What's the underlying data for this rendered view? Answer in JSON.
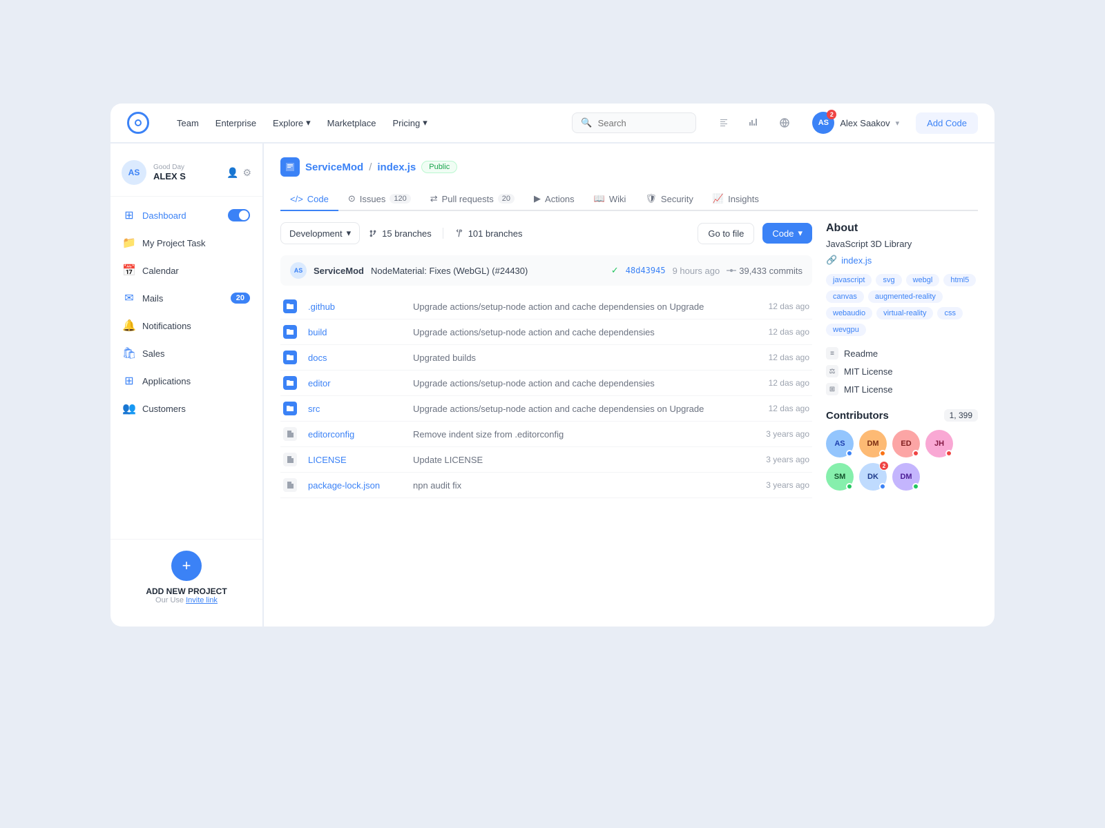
{
  "topNav": {
    "links": [
      {
        "label": "Team",
        "hasDropdown": false
      },
      {
        "label": "Enterprise",
        "hasDropdown": false
      },
      {
        "label": "Explore",
        "hasDropdown": true
      },
      {
        "label": "Marketplace",
        "hasDropdown": false
      },
      {
        "label": "Pricing",
        "hasDropdown": true
      }
    ],
    "search": {
      "placeholder": "Search"
    },
    "user": {
      "initials": "AS",
      "name": "Alex Saakov",
      "badgeCount": "2"
    },
    "addCodeLabel": "Add Code"
  },
  "sidebar": {
    "user": {
      "greeting": "Good Day",
      "name": "ALEX S",
      "initials": "AS"
    },
    "items": [
      {
        "label": "Dashboard",
        "icon": "grid",
        "active": true,
        "hasToggle": true
      },
      {
        "label": "My Project Task",
        "icon": "folder",
        "active": false
      },
      {
        "label": "Calendar",
        "icon": "calendar",
        "active": false
      },
      {
        "label": "Mails",
        "icon": "mail",
        "active": false,
        "badge": "20"
      },
      {
        "label": "Notifications",
        "icon": "bell",
        "active": false
      },
      {
        "label": "Sales",
        "icon": "bag",
        "active": false
      },
      {
        "label": "Applications",
        "icon": "apps",
        "active": false
      },
      {
        "label": "Customers",
        "icon": "people",
        "active": false
      }
    ],
    "addProject": {
      "title": "ADD NEW PROJECT",
      "subtitle": "Our Use",
      "inviteLabel": "Invite link"
    }
  },
  "repo": {
    "icon": "📄",
    "name": "ServiceMod",
    "file": "index.js",
    "visibility": "Public",
    "tabs": [
      {
        "label": "Code",
        "icon": "code",
        "count": null
      },
      {
        "label": "Issues",
        "icon": "circle",
        "count": "120"
      },
      {
        "label": "Pull requests",
        "icon": "git",
        "count": "20"
      },
      {
        "label": "Actions",
        "icon": "play",
        "count": null
      },
      {
        "label": "Wiki",
        "icon": "book",
        "count": null
      },
      {
        "label": "Security",
        "icon": "shield",
        "count": null
      },
      {
        "label": "Insights",
        "icon": "chart",
        "count": null
      }
    ],
    "branch": {
      "current": "Development",
      "branchCount15": "15 branches",
      "branchCount101": "101 branches",
      "gotoFile": "Go to file",
      "codeLabel": "Code"
    },
    "latestCommit": {
      "initials": "AS",
      "user": "ServiceMod",
      "message": "NodeMaterial: Fixes (WebGL) (#24430)",
      "hash": "48d43945",
      "time": "9 hours ago",
      "commits": "39,433 commits"
    },
    "files": [
      {
        "type": "folder",
        "name": ".github",
        "message": "Upgrade actions/setup-node action and cache dependensies on Upgrade",
        "time": "12 das ago"
      },
      {
        "type": "folder",
        "name": "build",
        "message": "Upgrade actions/setup-node action and cache dependensies",
        "time": "12 das ago"
      },
      {
        "type": "folder",
        "name": "docs",
        "message": "Upgrated builds",
        "time": "12 das ago"
      },
      {
        "type": "folder",
        "name": "editor",
        "message": "Upgrade actions/setup-node action and cache dependensies",
        "time": "12 das ago"
      },
      {
        "type": "folder",
        "name": "src",
        "message": "Upgrade actions/setup-node action and cache dependensies on Upgrade",
        "time": "12 das ago"
      },
      {
        "type": "file",
        "name": "editorconfig",
        "message": "Remove indent size from .editorconfig",
        "time": "3 years ago"
      },
      {
        "type": "file",
        "name": "LICENSE",
        "message": "Update LICENSE",
        "time": "3 years ago"
      },
      {
        "type": "file",
        "name": "package-lock.json",
        "message": "npn audit fix",
        "time": "3 years ago"
      }
    ]
  },
  "about": {
    "title": "About",
    "description": "JavaScript 3D Library",
    "link": "index.js",
    "tags": [
      "javascript",
      "svg",
      "webgl",
      "html5",
      "canvas",
      "augmented-reality",
      "webaudio",
      "virtual-reality",
      "css",
      "wevgpu"
    ],
    "meta": [
      {
        "icon": "📄",
        "label": "Readme"
      },
      {
        "icon": "⚖",
        "label": "MIT License"
      },
      {
        "icon": "⚖",
        "label": "MIT License"
      }
    ],
    "contributors": {
      "title": "Contributors",
      "count": "1, 399",
      "list": [
        {
          "initials": "AS",
          "color": "#93c5fd",
          "textColor": "#1e40af",
          "dot": "blue"
        },
        {
          "initials": "DM",
          "color": "#fdba74",
          "textColor": "#7c2d12",
          "dot": "orange"
        },
        {
          "initials": "ED",
          "color": "#fca5a5",
          "textColor": "#7f1d1d",
          "dot": "red"
        },
        {
          "initials": "JH",
          "color": "#f9a8d4",
          "textColor": "#831843",
          "dot": "red"
        },
        {
          "initials": "SM",
          "color": "#86efac",
          "textColor": "#14532d",
          "dot": "green"
        },
        {
          "initials": "DK",
          "color": "#bfdbfe",
          "textColor": "#1e3a8a",
          "dot": "blue",
          "badge": "2"
        },
        {
          "initials": "DM",
          "color": "#c4b5fd",
          "textColor": "#4c1d95",
          "dot": "green"
        }
      ]
    }
  }
}
